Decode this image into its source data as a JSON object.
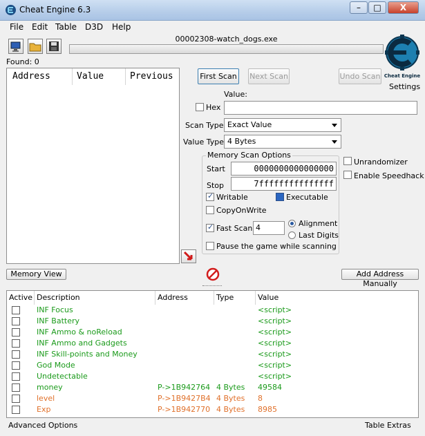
{
  "window": {
    "title": "Cheat Engine 6.3",
    "minimize": "–",
    "maximize": "□",
    "close": "X"
  },
  "menu": [
    "File",
    "Edit",
    "Table",
    "D3D",
    "Help"
  ],
  "process": "00002308-watch_dogs.exe",
  "found_label": "Found: 0",
  "results_columns": [
    "Address",
    "Value",
    "Previous"
  ],
  "buttons": {
    "first_scan": "First Scan",
    "next_scan": "Next Scan",
    "undo_scan": "Undo Scan",
    "settings": "Settings",
    "memory_view": "Memory View",
    "add_address": "Add Address Manually"
  },
  "scan": {
    "value_label": "Value:",
    "hex_label": "Hex",
    "value": "",
    "scan_type_label": "Scan Type",
    "scan_type": "Exact Value",
    "value_type_label": "Value Type",
    "value_type": "4 Bytes"
  },
  "memory_options": {
    "title": "Memory Scan Options",
    "start_label": "Start",
    "start": "0000000000000000",
    "stop_label": "Stop",
    "stop": "7fffffffffffffff",
    "writable": "Writable",
    "executable": "Executable",
    "copy_on_write": "CopyOnWrite",
    "fast_scan": "Fast Scan",
    "fast_scan_value": "4",
    "alignment": "Alignment",
    "last_digits": "Last Digits",
    "pause": "Pause the game while scanning"
  },
  "options": {
    "unrandomizer": "Unrandomizer",
    "speedhack": "Enable Speedhack"
  },
  "table_columns": [
    "Active",
    "Description",
    "Address",
    "Type",
    "Value"
  ],
  "table_rows": [
    {
      "description": "INF Focus",
      "address": "",
      "type": "",
      "value": "<script>",
      "color": "#1a9a1a"
    },
    {
      "description": "INF Battery",
      "address": "",
      "type": "",
      "value": "<script>",
      "color": "#1a9a1a"
    },
    {
      "description": "INF Ammo & noReload",
      "address": "",
      "type": "",
      "value": "<script>",
      "color": "#1a9a1a"
    },
    {
      "description": "INF Ammo and Gadgets",
      "address": "",
      "type": "",
      "value": "<script>",
      "color": "#1a9a1a"
    },
    {
      "description": "INF Skill-points and Money",
      "address": "",
      "type": "",
      "value": "<script>",
      "color": "#1a9a1a"
    },
    {
      "description": "God Mode",
      "address": "",
      "type": "",
      "value": "<script>",
      "color": "#1a9a1a"
    },
    {
      "description": "Undetectable",
      "address": "",
      "type": "",
      "value": "<script>",
      "color": "#1a9a1a"
    },
    {
      "description": "money",
      "address": "P->1B942764",
      "type": "4 Bytes",
      "value": "49584",
      "color": "#1a9a1a"
    },
    {
      "description": "level",
      "address": "P->1B9427B4",
      "type": "4 Bytes",
      "value": "8",
      "color": "#e0702a"
    },
    {
      "description": "Exp",
      "address": "P->1B942770",
      "type": "4 Bytes",
      "value": "8985",
      "color": "#e0702a"
    }
  ],
  "footer": {
    "advanced": "Advanced Options",
    "extras": "Table Extras"
  }
}
